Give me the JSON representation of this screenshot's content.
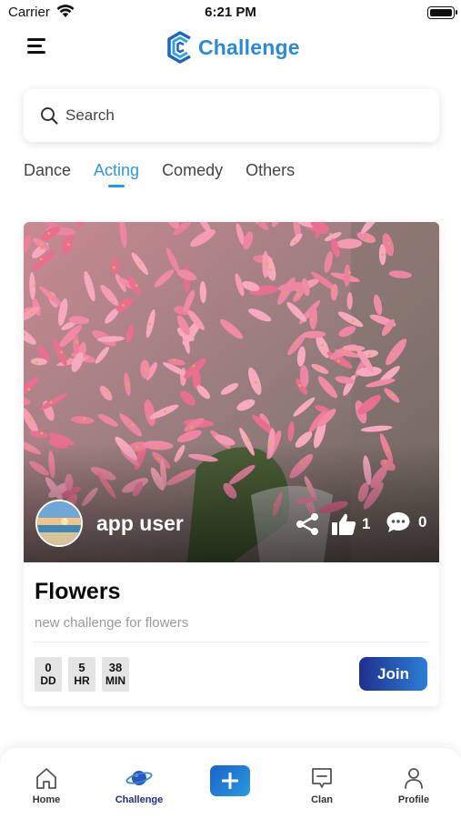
{
  "status_bar": {
    "carrier": "Carrier",
    "time": "6:21 PM",
    "icons": [
      "wifi-icon",
      "battery-icon"
    ]
  },
  "header": {
    "menu_icon": "hamburger-menu-icon",
    "logo_icon": "challenge-logo-icon",
    "title": "Challenge"
  },
  "search": {
    "placeholder": "Search",
    "value": "",
    "icon": "search-icon"
  },
  "tabs": [
    {
      "label": "Dance",
      "active": false
    },
    {
      "label": "Acting",
      "active": true
    },
    {
      "label": "Comedy",
      "active": false
    },
    {
      "label": "Others",
      "active": false
    }
  ],
  "challenge_card": {
    "image": "pink-flowers-photo",
    "user": {
      "name": "app user",
      "avatar": "beach-sunset-avatar"
    },
    "actions": {
      "share_icon": "share-icon",
      "like_icon": "thumbs-up-icon",
      "likes": "1",
      "comment_icon": "comment-icon",
      "comments": "0"
    },
    "title": "Flowers",
    "description": "new challenge for flowers",
    "countdown": [
      {
        "value": "0",
        "unit": "DD"
      },
      {
        "value": "5",
        "unit": "HR"
      },
      {
        "value": "38",
        "unit": "MIN"
      }
    ],
    "join_label": "Join"
  },
  "bottom_nav": {
    "items": [
      {
        "label": "Home",
        "icon": "home-icon",
        "active": false
      },
      {
        "label": "Challenge",
        "icon": "planet-icon",
        "active": true
      },
      {
        "label": "Clan",
        "icon": "chat-box-icon",
        "active": false
      },
      {
        "label": "Profile",
        "icon": "person-icon",
        "active": false
      }
    ],
    "add_icon": "plus-icon"
  },
  "colors": {
    "accent": "#2a9ad8",
    "brand_dark": "#1f2f8e",
    "muted_text": "#9a9a9a"
  }
}
